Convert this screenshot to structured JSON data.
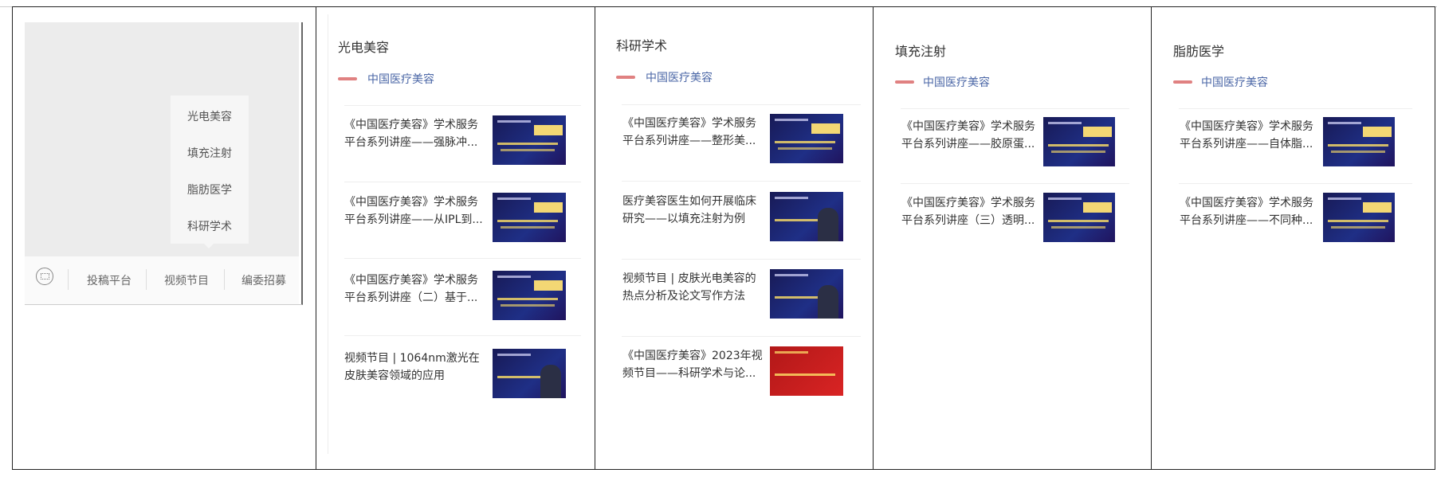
{
  "phone": {
    "popup_items": [
      "光电美容",
      "填充注射",
      "脂肪医学",
      "科研学术"
    ],
    "tabs": [
      "投稿平台",
      "视频节目",
      "编委招募"
    ]
  },
  "columns": [
    {
      "title": "光电美容",
      "source": "中国医疗美容",
      "items": [
        {
          "title": "《中国医疗美容》学术服务平台系列讲座——强脉冲...",
          "thumb_color": "#1b1f63"
        },
        {
          "title": "《中国医疗美容》学术服务平台系列讲座——从IPL到...",
          "thumb_color": "#1b1f63"
        },
        {
          "title": "《中国医疗美容》学术服务平台系列讲座（二）基于...",
          "thumb_color": "#1b1f63"
        },
        {
          "title": "视频节目 | 1064nm激光在皮肤美容领域的应用",
          "thumb_color": "#1b3f8a"
        }
      ]
    },
    {
      "title": "科研学术",
      "source": "中国医疗美容",
      "items": [
        {
          "title": "《中国医疗美容》学术服务平台系列讲座——整形美...",
          "thumb_color": "#1b1f63"
        },
        {
          "title": "医疗美容医生如何开展临床研究——以填充注射为例",
          "thumb_color": "#1b3f8a"
        },
        {
          "title": "视频节目 | 皮肤光电美容的热点分析及论文写作方法",
          "thumb_color": "#1b3f8a"
        },
        {
          "title": "《中国医疗美容》2023年视频节目——科研学术与论...",
          "thumb_color": "#c81e1e"
        }
      ]
    },
    {
      "title": "填充注射",
      "source": "中国医疗美容",
      "items": [
        {
          "title": "《中国医疗美容》学术服务平台系列讲座——胶原蛋...",
          "thumb_color": "#1b1f63"
        },
        {
          "title": "《中国医疗美容》学术服务平台系列讲座（三）透明...",
          "thumb_color": "#1b1f63"
        }
      ]
    },
    {
      "title": "脂肪医学",
      "source": "中国医疗美容",
      "items": [
        {
          "title": "《中国医疗美容》学术服务平台系列讲座——自体脂...",
          "thumb_color": "#1b1f63"
        },
        {
          "title": "《中国医疗美容》学术服务平台系列讲座——不同种...",
          "thumb_color": "#1b1f63"
        }
      ]
    }
  ]
}
